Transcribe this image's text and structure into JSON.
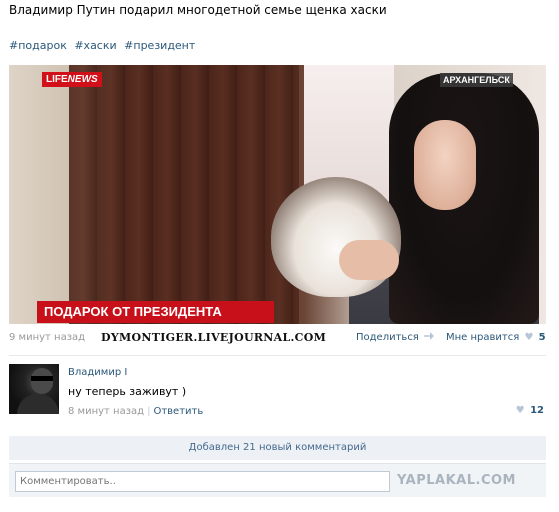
{
  "post": {
    "title": "Владимир Путин подарил многодетной семье щенка хаски",
    "hashtags": [
      "#подарок",
      "#хаски",
      "#президент"
    ]
  },
  "video": {
    "channel_logo_life": "LIFE",
    "channel_logo_news": "NEWS",
    "location": "АРХАНГЕЛЬСК",
    "banner": "ПОДАРОК ОТ ПРЕЗИДЕНТА"
  },
  "meta": {
    "time": "9 минут назад",
    "watermark": "DYMONTIGER.LIVEJOURNAL.COM",
    "share_label": "Поделиться",
    "like_label": "Мне нравится",
    "like_count": "5"
  },
  "comment": {
    "author": "Владимир I",
    "text": "ну теперь заживут )",
    "time": "8 минут назад",
    "reply_label": "Ответить",
    "like_count": "12"
  },
  "added_comments": "Добавлен 21 новый комментарий",
  "reply_input": {
    "placeholder": "Комментировать.."
  },
  "watermark_bottom": "YAPLAKAL.COM",
  "colors": {
    "link": "#2b587a",
    "muted": "#999999",
    "banner_red": "#c8101a"
  }
}
